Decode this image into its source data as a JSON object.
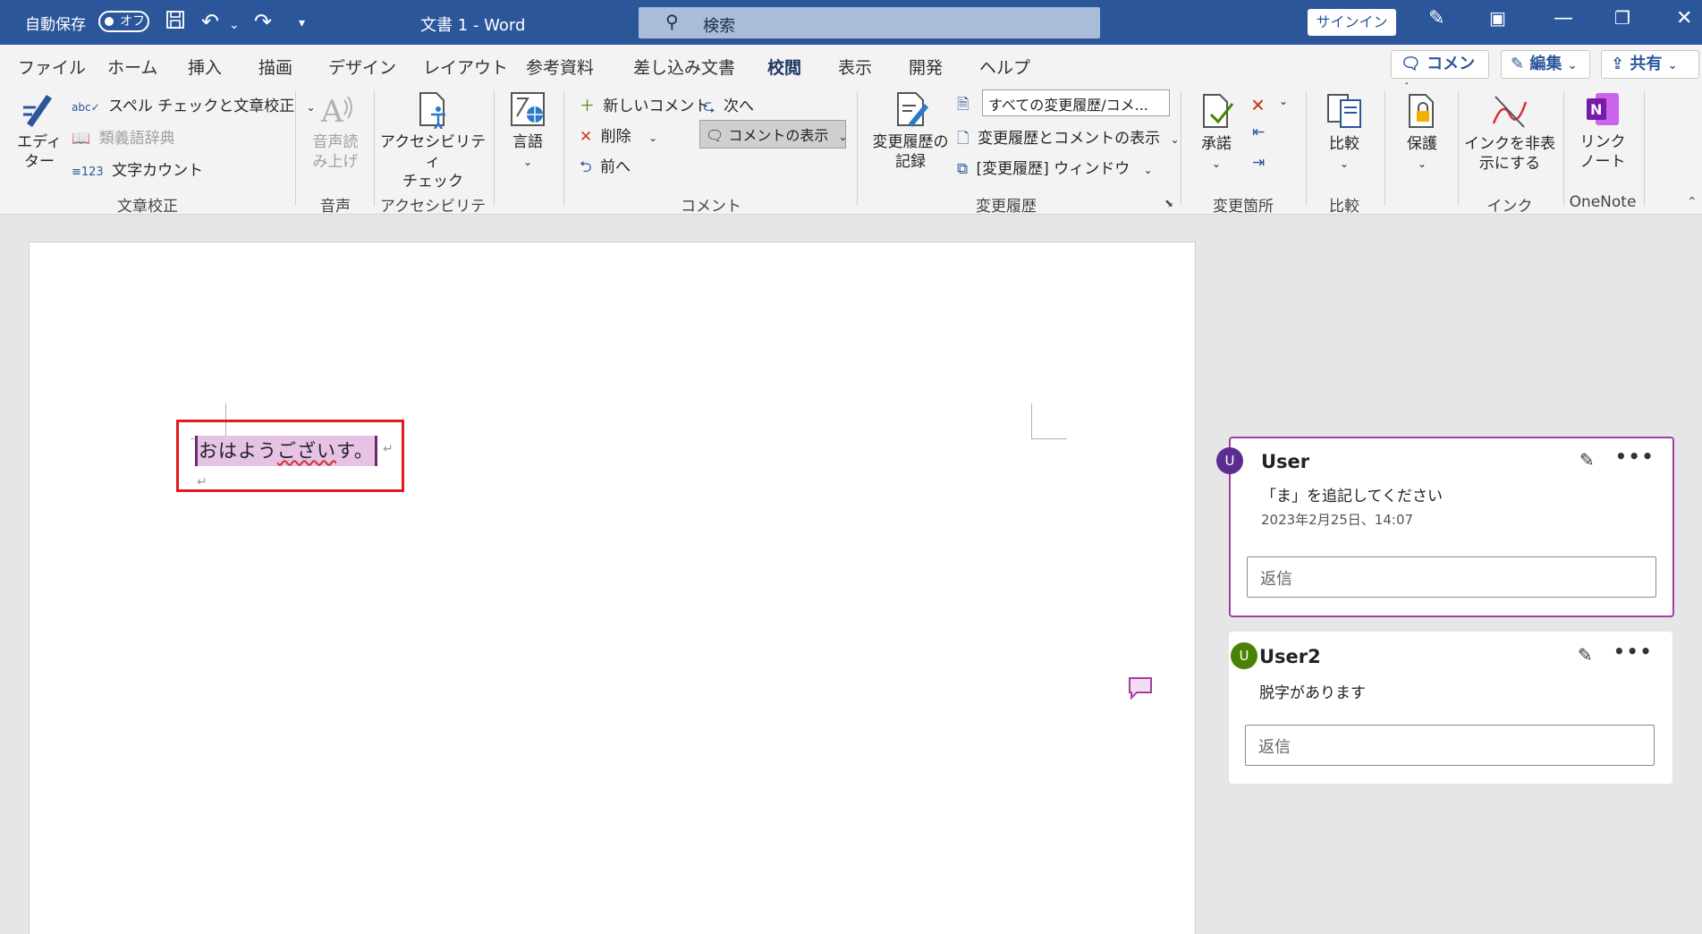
{
  "titlebar": {
    "autosave_label": "自動保存",
    "autosave_state": "オフ",
    "doc_title": "文書 1  -  Word",
    "search_placeholder": "検索",
    "signin_label": "サインイン"
  },
  "tabs": [
    "ファイル",
    "ホーム",
    "挿入",
    "描画",
    "デザイン",
    "レイアウト",
    "参考資料",
    "差し込み文書",
    "校閲",
    "表示",
    "開発",
    "ヘルプ"
  ],
  "active_tab": "校閲",
  "tab_actions": {
    "comment": "コメント",
    "edit": "編集",
    "share": "共有"
  },
  "ribbon": {
    "proofing": {
      "label": "文章校正",
      "editor": "エディ\nター",
      "spell": "スペル チェックと文章校正",
      "thesaurus": "類義語辞典",
      "wordcount": "文字カウント"
    },
    "speech": {
      "label": "音声",
      "read_aloud": "音声読\nみ上げ"
    },
    "accessibility": {
      "label": "アクセシビリティ",
      "check": "アクセシビリティ\nチェック"
    },
    "language": {
      "label": "言語"
    },
    "comments": {
      "label": "コメント",
      "new": "新しいコメント",
      "delete": "削除",
      "prev": "前へ",
      "next": "次へ",
      "show": "コメントの表示"
    },
    "tracking": {
      "label": "変更履歴",
      "track_changes": "変更履歴の\n記録",
      "markup_select": "すべての変更履歴/コメ...",
      "show_markup": "変更履歴とコメントの表示",
      "review_pane": "[変更履歴] ウィンドウ"
    },
    "changes": {
      "label": "変更箇所",
      "accept": "承諾"
    },
    "compare": {
      "label": "比較",
      "compare_btn": "比較"
    },
    "protect": {
      "label": "保護"
    },
    "ink": {
      "label": "インク",
      "hide_ink": "インクを非表\n示にする"
    },
    "onenote": {
      "label": "OneNote",
      "linked_notes": "リンク\nノート"
    }
  },
  "document": {
    "text_pre": "おはよう",
    "text_err": "ござい",
    "text_post": "す。"
  },
  "comments": [
    {
      "initial": "U",
      "user": "User",
      "text": "「ま」を追記してください",
      "date": "2023年2月25日、14:07",
      "reply_placeholder": "返信",
      "avatar_color": "#5c2d91"
    },
    {
      "initial": "U",
      "user": "User2",
      "text": "脱字があります",
      "reply_placeholder": "返信",
      "avatar_color": "#498205"
    }
  ]
}
